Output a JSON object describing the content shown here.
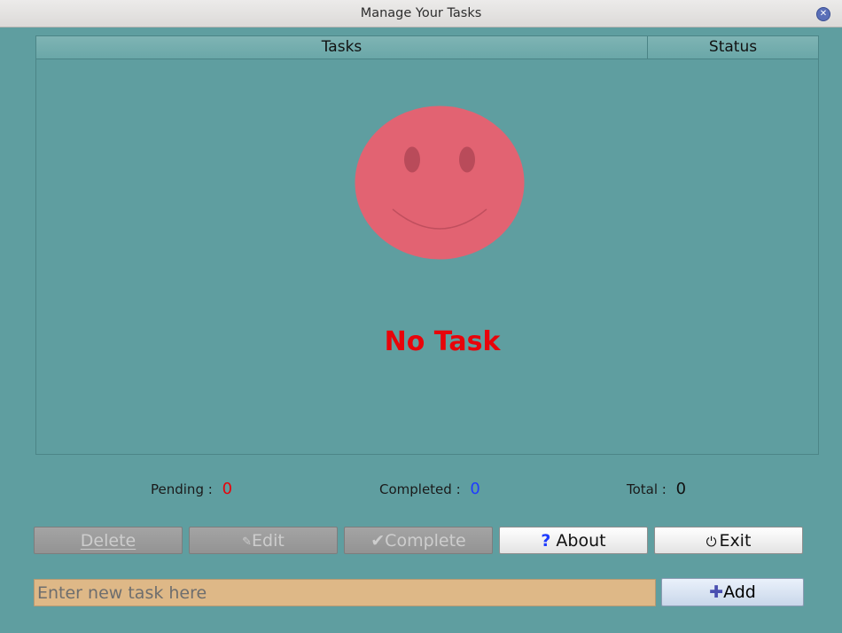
{
  "window": {
    "title": "Manage Your Tasks",
    "close_icon": "close-icon"
  },
  "table": {
    "columns": [
      "Tasks",
      "Status"
    ],
    "rows": [],
    "empty_message": "No Task",
    "empty_icon": "smiley-face-icon"
  },
  "stats": {
    "pending_label": "Pending :",
    "pending_value": "0",
    "completed_label": "Completed :",
    "completed_value": "0",
    "total_label": "Total :",
    "total_value": "0"
  },
  "buttons": {
    "delete": {
      "label": "Delete",
      "mnemonic": "D",
      "enabled": false
    },
    "edit": {
      "label": "Edit",
      "mnemonic": "E",
      "icon": "pencil-icon",
      "enabled": false
    },
    "complete": {
      "label": "Complete",
      "mnemonic": "C",
      "icon": "checkmark-icon",
      "enabled": false
    },
    "about": {
      "label": "About",
      "mnemonic": "b",
      "icon": "question-mark-icon",
      "enabled": true
    },
    "exit": {
      "label": "Exit",
      "mnemonic": "x",
      "icon": "power-icon",
      "enabled": true
    },
    "add": {
      "label": "Add",
      "mnemonic": "A",
      "icon": "plus-icon",
      "enabled": true
    }
  },
  "input": {
    "placeholder": "Enter new task here",
    "value": ""
  },
  "colors": {
    "background": "#5f9ea0",
    "pending_value": "#e8040a",
    "completed_value": "#1f3cff",
    "total_value": "#111111",
    "no_task_text": "#e8040a",
    "smiley_face": "#e26372",
    "input_background": "#deb887"
  }
}
